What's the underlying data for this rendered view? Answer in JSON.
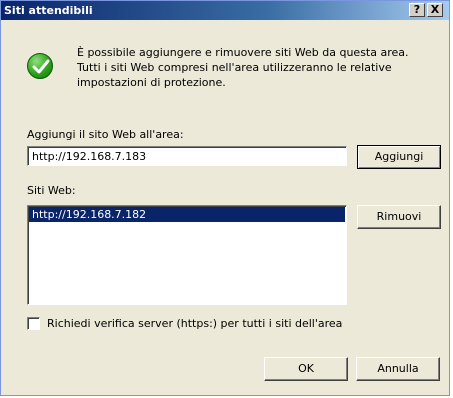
{
  "window": {
    "title": "Siti attendibili",
    "help_label": "?",
    "close_label": "X"
  },
  "info": {
    "icon": "checkmark-icon",
    "line1": "È possibile aggiungere e rimuovere siti Web da questa area.",
    "line2": "Tutti i siti Web compresi nell'area utilizzeranno le relative",
    "line3": "impostazioni di protezione."
  },
  "add_site": {
    "label": "Aggiungi il sito Web all'area:",
    "value": "http://192.168.7.183",
    "button_label": "Aggiungi"
  },
  "sites": {
    "label": "Siti Web:",
    "items": [
      "http://192.168.7.182"
    ],
    "remove_label": "Rimuovi"
  },
  "https_option": {
    "label": "Richiedi verifica server (https:) per tutti i siti dell'area",
    "checked": false
  },
  "footer": {
    "ok_label": "OK",
    "cancel_label": "Annulla"
  },
  "colors": {
    "title_bar": "#0a246a",
    "dialog_bg": "#ece9d8",
    "selection": "#0a246a",
    "check_green": "#2ea01e"
  }
}
